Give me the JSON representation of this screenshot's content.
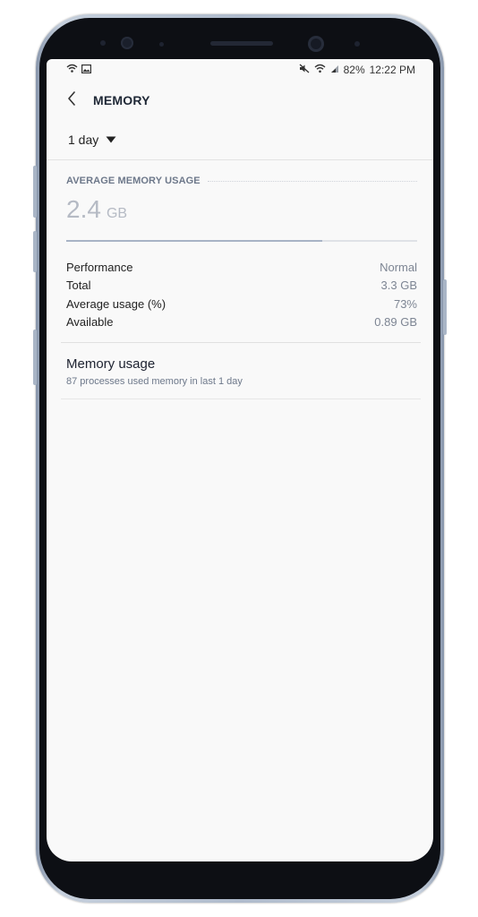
{
  "status_bar": {
    "left_icons": [
      "wifi-calling-icon",
      "gallery-icon"
    ],
    "right_icons": [
      "mute-icon",
      "wifi-icon",
      "signal-icon"
    ],
    "battery": "82%",
    "time": "12:22 PM"
  },
  "app_bar": {
    "back_icon": "chevron-left-icon",
    "title": "MEMORY"
  },
  "period": {
    "selected": "1 day",
    "icon": "dropdown-triangle-icon"
  },
  "average_usage": {
    "header": "AVERAGE MEMORY USAGE",
    "value": "2.4",
    "unit": "GB",
    "progress_fraction": 0.73
  },
  "stats": [
    {
      "label": "Performance",
      "value": "Normal"
    },
    {
      "label": "Total",
      "value": "3.3 GB"
    },
    {
      "label": "Average usage (%)",
      "value": "73%"
    },
    {
      "label": "Available",
      "value": "0.89 GB"
    }
  ],
  "memory_usage_item": {
    "title": "Memory usage",
    "subtitle": "87 processes used memory in last 1 day"
  },
  "colors": {
    "screen_bg": "#f9f9f9",
    "title_text": "#1f2836",
    "muted_text": "#6d788a",
    "progress_fill": "#a8b4c6",
    "frame": "#aebacb"
  }
}
